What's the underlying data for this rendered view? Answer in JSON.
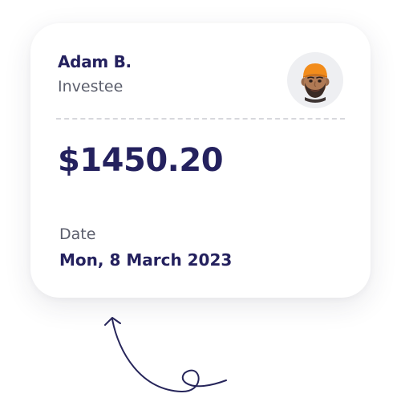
{
  "card": {
    "name": "Adam B.",
    "role": "Investee",
    "amount": "$1450.20",
    "date_label": "Date",
    "date_value": "Mon, 8 March 2023"
  },
  "icons": {
    "avatar": "memoji-avatar-orange-cap",
    "arrow": "curly-arrow-up-icon"
  },
  "colors": {
    "primary_text": "#24215e",
    "secondary_text": "#5b5e6c",
    "card_background": "#ffffff",
    "avatar_background": "#eeeff2",
    "divider": "#d7d8dd",
    "arrow": "#26255a"
  }
}
